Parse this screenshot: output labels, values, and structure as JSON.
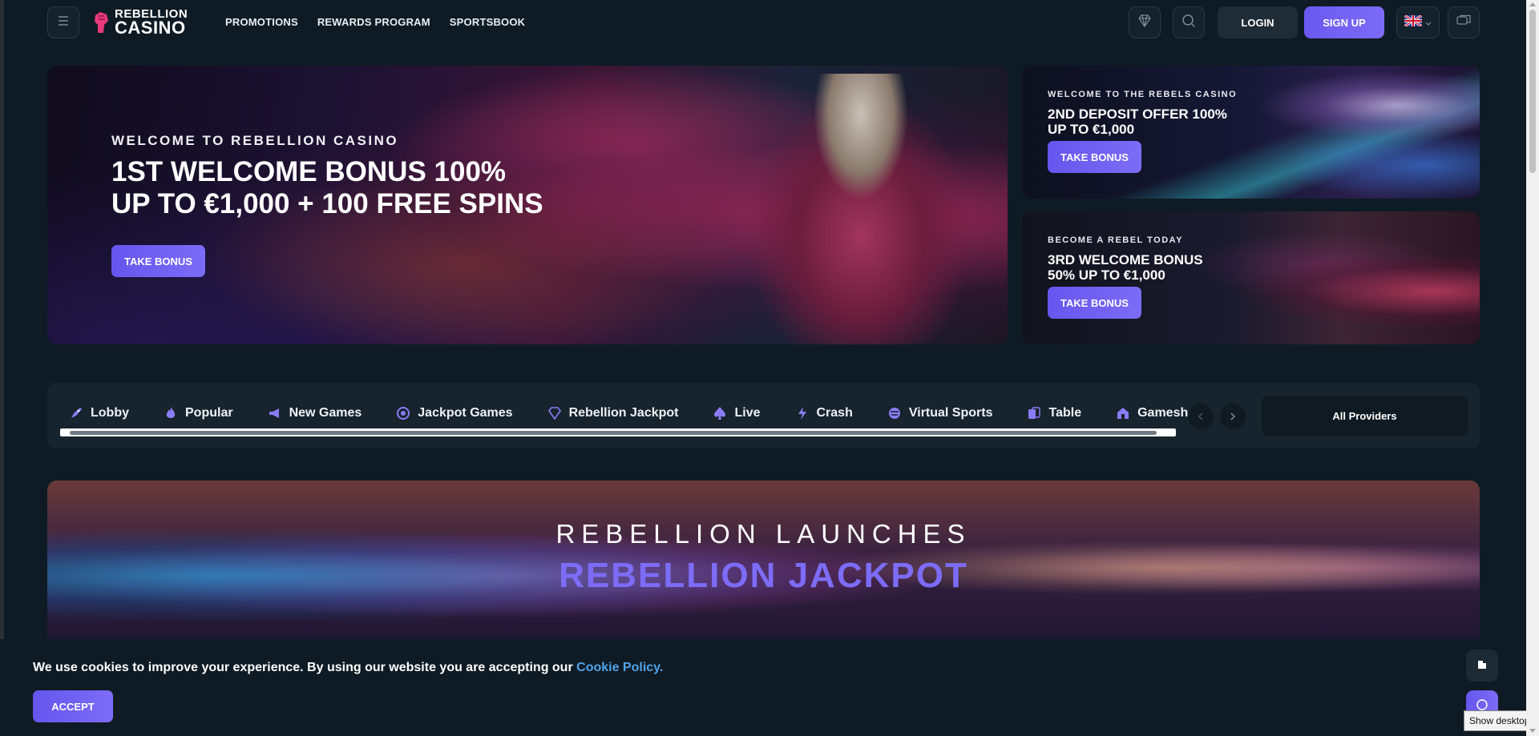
{
  "header": {
    "logo": {
      "line1": "REBELLION",
      "line2": "CASINO"
    },
    "nav": [
      "PROMOTIONS",
      "REWARDS PROGRAM",
      "SPORTSBOOK"
    ],
    "login_label": "LOGIN",
    "signup_label": "SIGN UP",
    "icons": [
      "menu-icon",
      "diamond-icon",
      "search-icon",
      "uk-flag-icon",
      "chat-icon"
    ]
  },
  "hero": {
    "main": {
      "kicker": "WELCOME TO REBELLION CASINO",
      "title_line1": "1ST WELCOME BONUS 100%",
      "title_line2": "UP TO €1,000 + 100 FREE SPINS",
      "button": "TAKE BONUS"
    },
    "side": [
      {
        "kicker": "WELCOME TO THE REBELS CASINO",
        "title_line1": "2ND DEPOSIT OFFER 100%",
        "title_line2": "UP TO €1,000",
        "button": "TAKE BONUS"
      },
      {
        "kicker": "BECOME A REBEL TODAY",
        "title_line1": "3RD WELCOME BONUS",
        "title_line2": "50% UP TO €1,000",
        "button": "TAKE BONUS"
      }
    ]
  },
  "categories": {
    "items": [
      "Lobby",
      "Popular",
      "New Games",
      "Jackpot Games",
      "Rebellion Jackpot",
      "Live",
      "Crash",
      "Virtual Sports",
      "Table",
      "Gameshows"
    ],
    "providers_label": "All Providers"
  },
  "promo": {
    "line1": "REBELLION LAUNCHES",
    "line2": "REBELLION JACKPOT"
  },
  "cookie": {
    "text": "We use cookies to improve your experience. By using our website you are accepting our",
    "link": "Cookie Policy.",
    "accept": "ACCEPT"
  },
  "tooltip": "Show desktop",
  "colors": {
    "accent": "#7c6cf7",
    "background": "#0f1b24",
    "link": "#4fa3ea"
  }
}
